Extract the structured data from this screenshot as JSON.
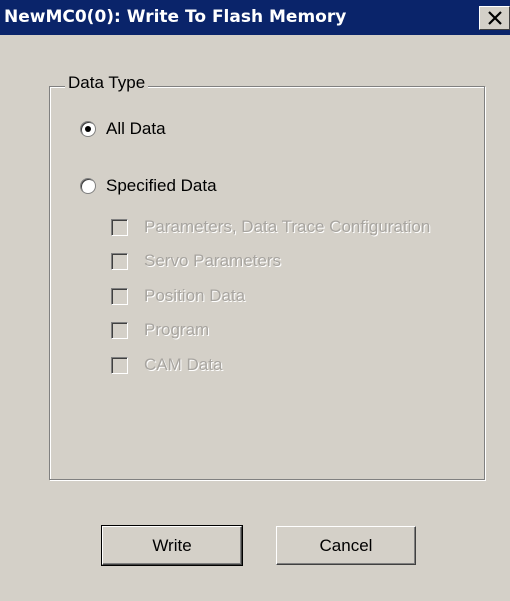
{
  "window": {
    "title": "NewMC0(0): Write To Flash Memory",
    "close_label": "X"
  },
  "data_type_group": {
    "label": "Data Type",
    "options": [
      {
        "label": "All Data",
        "selected": true
      },
      {
        "label": "Specified Data",
        "selected": false
      }
    ],
    "specified_items": [
      {
        "label": "Parameters, Data Trace Configuration",
        "checked": false,
        "enabled": false
      },
      {
        "label": "Servo Parameters",
        "checked": false,
        "enabled": false
      },
      {
        "label": "Position Data",
        "checked": false,
        "enabled": false
      },
      {
        "label": "Program",
        "checked": false,
        "enabled": false
      },
      {
        "label": "CAM Data",
        "checked": false,
        "enabled": false
      }
    ]
  },
  "buttons": {
    "write": "Write",
    "cancel": "Cancel"
  },
  "colors": {
    "titlebar": "#0a246a",
    "face": "#d4d0c8",
    "disabled_text": "#a8a5a0"
  }
}
